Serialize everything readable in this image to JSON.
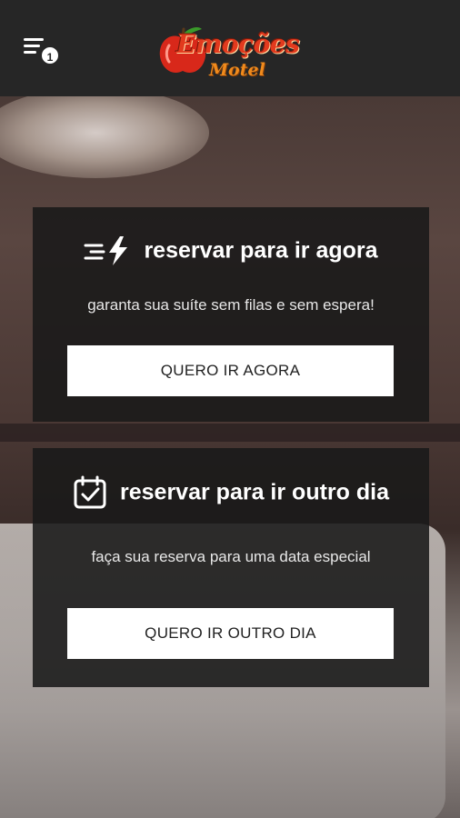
{
  "header": {
    "menu_badge": "1",
    "logo_line1": "Emoções",
    "logo_line2": "Motel"
  },
  "cards": [
    {
      "title": "reservar para ir agora",
      "subtitle": "garanta sua suíte sem filas e sem espera!",
      "button": "QUERO IR AGORA",
      "icon": "lightning-speed-icon"
    },
    {
      "title": "reservar para ir outro dia",
      "subtitle": "faça sua reserva para uma data especial",
      "button": "QUERO IR OUTRO DIA",
      "icon": "calendar-check-icon"
    }
  ],
  "colors": {
    "topbar": "#262626",
    "card_bg": "#191919",
    "button_bg": "#ffffff",
    "logo_red": "#e23a1e",
    "logo_orange": "#f08a1c"
  }
}
